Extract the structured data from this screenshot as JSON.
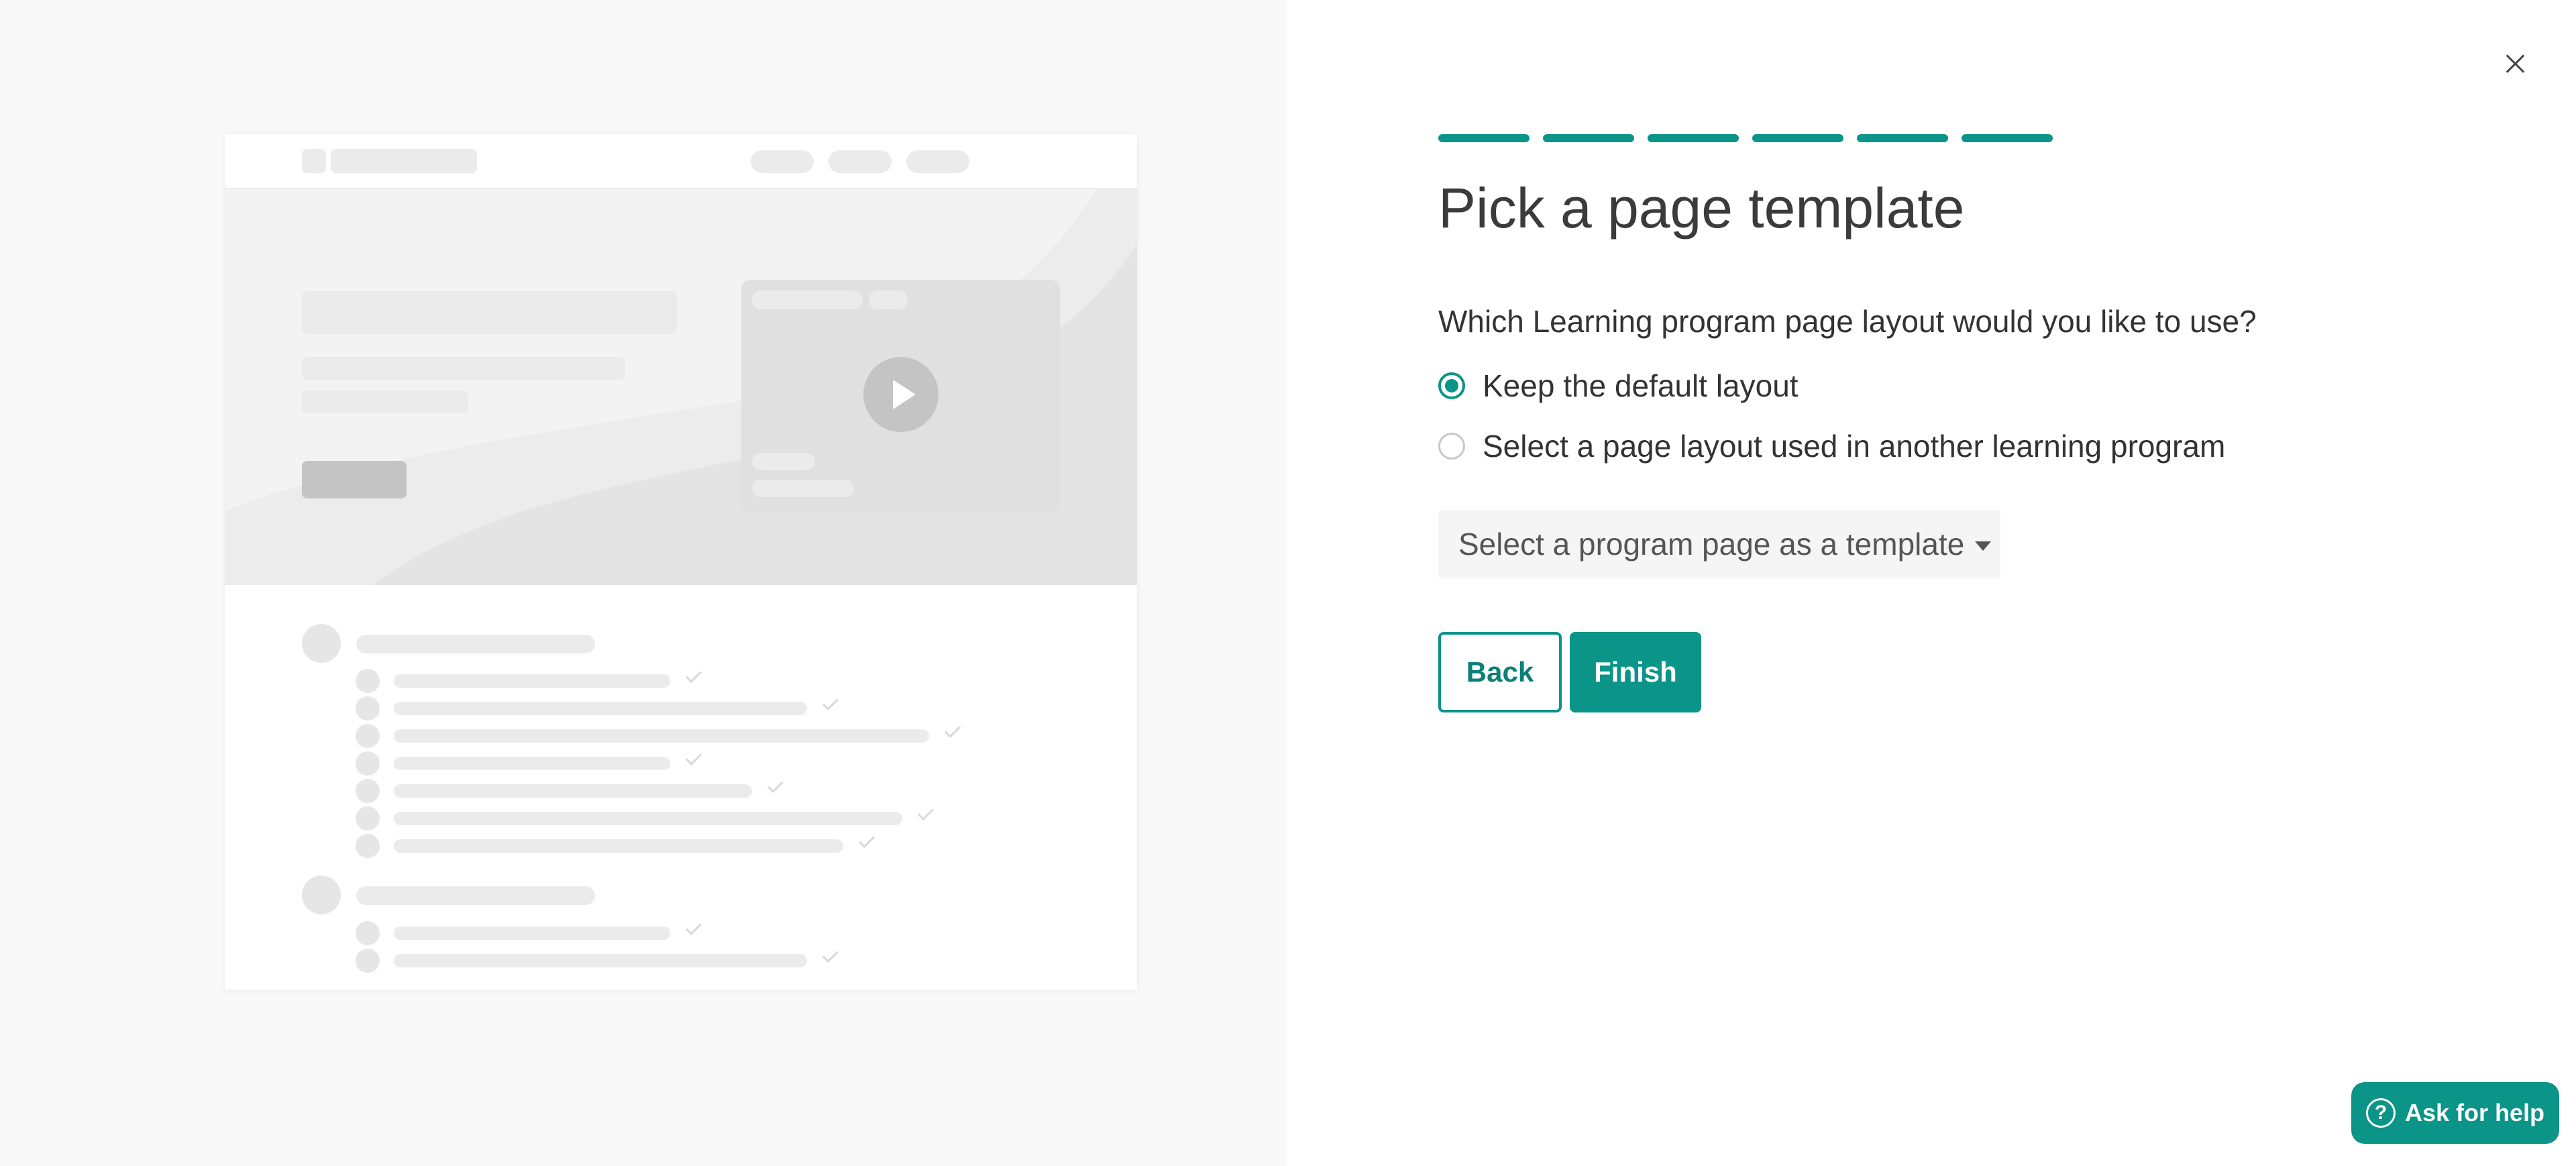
{
  "dialog": {
    "title": "Pick a page template",
    "steps_total": 6,
    "steps_completed": 6,
    "question": "Which Learning program page layout would you like to use?"
  },
  "options": [
    {
      "label": "Keep the default layout",
      "selected": true
    },
    {
      "label": "Select a page layout used in another learning program",
      "selected": false
    }
  ],
  "template_select": {
    "placeholder": "Select a program page as a template"
  },
  "buttons": {
    "back": "Back",
    "finish": "Finish",
    "help": "Ask for help"
  },
  "icons": {
    "close": "close-icon",
    "help": "question-circle-icon",
    "play": "play-icon",
    "dropdown": "caret-down-icon"
  },
  "colors": {
    "accent": "#0b9488",
    "left_background": "#f8f8f8"
  }
}
